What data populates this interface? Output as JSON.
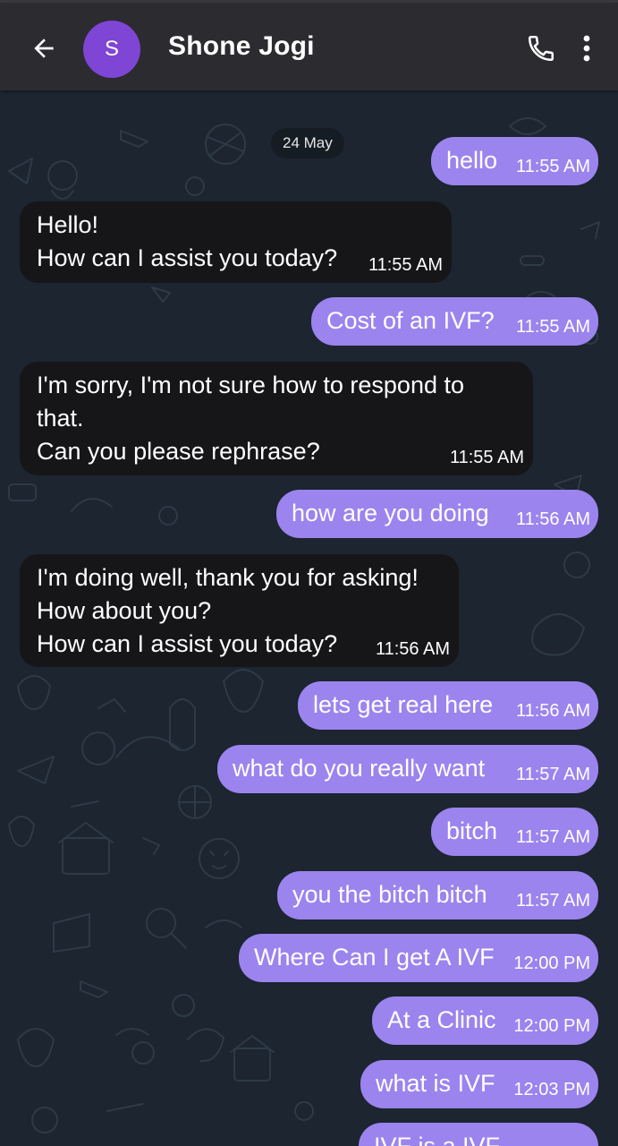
{
  "header": {
    "back_icon": "arrow-left-icon",
    "avatar_letter": "S",
    "contact_name": "Shone Jogi",
    "call_icon": "phone-icon",
    "more_icon": "more-vertical-icon"
  },
  "colors": {
    "appbar": "#2b2b30",
    "chat_background": "#1c2530",
    "outgoing_bubble": "#9b84ee",
    "incoming_bubble": "#161619",
    "avatar": "#7f45d4"
  },
  "chat": {
    "date": "24 May",
    "messages": [
      {
        "dir": "out",
        "text": "hello",
        "time": "11:55 AM"
      },
      {
        "dir": "in",
        "text": "Hello!\nHow can I assist you today?",
        "time": "11:55 AM"
      },
      {
        "dir": "out",
        "text": "Cost of an IVF?",
        "time": "11:55 AM"
      },
      {
        "dir": "in",
        "text": "I'm sorry, I'm not sure how to respond to\nthat.\nCan you please rephrase?",
        "time": "11:55 AM"
      },
      {
        "dir": "out",
        "text": "how are you doing",
        "time": "11:56 AM"
      },
      {
        "dir": "in",
        "text": "I'm doing well, thank you for asking!\nHow about you?\nHow can I assist you today?",
        "time": "11:56 AM"
      },
      {
        "dir": "out",
        "text": "lets get real here",
        "time": "11:56 AM"
      },
      {
        "dir": "out",
        "text": "what do you really want",
        "time": "11:57 AM"
      },
      {
        "dir": "out",
        "text": "bitch",
        "time": "11:57 AM"
      },
      {
        "dir": "out",
        "text": "you the bitch bitch",
        "time": "11:57 AM"
      },
      {
        "dir": "out",
        "text": "Where Can I get A IVF",
        "time": "12:00 PM"
      },
      {
        "dir": "out",
        "text": "At a Clinic",
        "time": "12:00 PM"
      },
      {
        "dir": "out",
        "text": "what is IVF",
        "time": "12:03 PM"
      },
      {
        "dir": "out",
        "text": "IVF is a IVF",
        "time": ""
      }
    ]
  }
}
